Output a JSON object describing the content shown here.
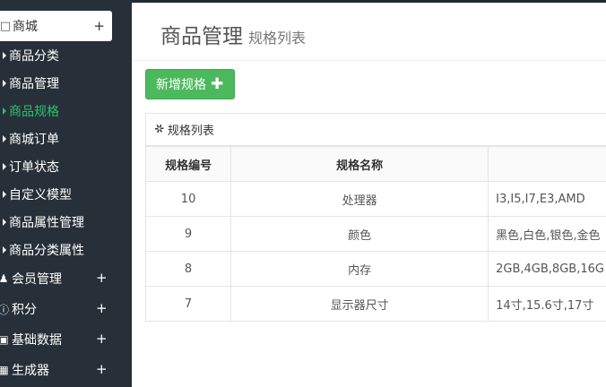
{
  "sidebar": {
    "header": {
      "label": "商城",
      "icon": "store-icon",
      "toggle": "+"
    },
    "sub_items": [
      {
        "label": "商品分类",
        "active": false
      },
      {
        "label": "商品管理",
        "active": false
      },
      {
        "label": "商品规格",
        "active": true
      },
      {
        "label": "商城订单",
        "active": false
      },
      {
        "label": "订单状态",
        "active": false
      },
      {
        "label": "自定义模型",
        "active": false
      },
      {
        "label": "商品属性管理",
        "active": false
      },
      {
        "label": "商品分类属性",
        "active": false
      }
    ],
    "groups": [
      {
        "label": "会员管理",
        "icon": "user-icon",
        "toggle": "+"
      },
      {
        "label": "积分",
        "icon": "info-circle-icon",
        "toggle": "+"
      },
      {
        "label": "基础数据",
        "icon": "image-icon",
        "toggle": "+"
      },
      {
        "label": "生成器",
        "icon": "grid-icon",
        "toggle": "+"
      }
    ]
  },
  "header": {
    "title": "商品管理",
    "subtitle": "规格列表"
  },
  "toolbar": {
    "add_label": "新增规格",
    "add_icon": "plus-icon"
  },
  "panel": {
    "title": "规格列表",
    "icon": "pin-icon"
  },
  "table": {
    "headers": [
      "规格编号",
      "规格名称",
      ""
    ],
    "rows": [
      {
        "id": "10",
        "name": "处理器",
        "values": "I3,I5,I7,E3,AMD"
      },
      {
        "id": "9",
        "name": "颜色",
        "values": "黑色,白色,银色,金色"
      },
      {
        "id": "8",
        "name": "内存",
        "values": "2GB,4GB,8GB,16G"
      },
      {
        "id": "7",
        "name": "显示器尺寸",
        "values": "14寸,15.6寸,17寸"
      }
    ]
  },
  "colors": {
    "sidebar_bg": "#273039",
    "active": "#2fbf71",
    "button_green": "#4cb95d"
  }
}
